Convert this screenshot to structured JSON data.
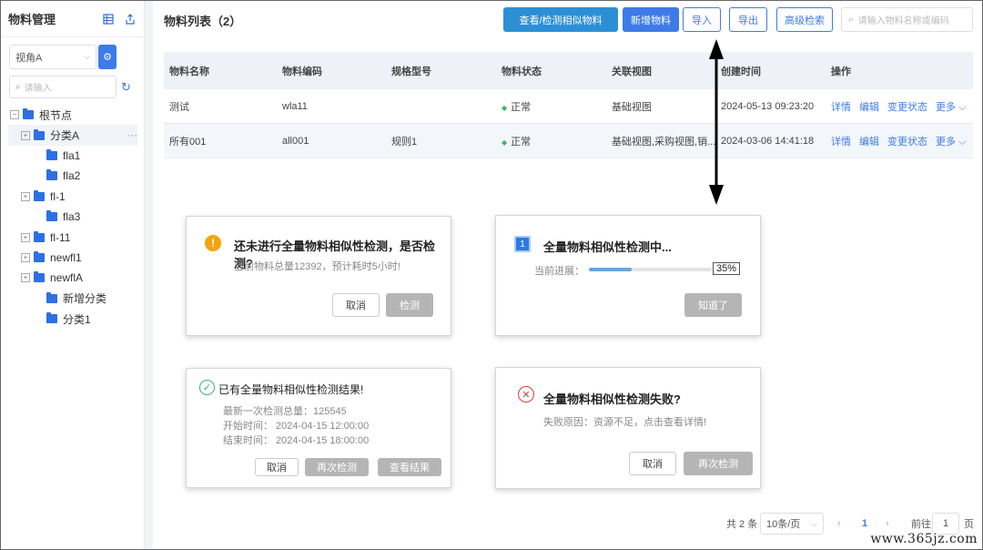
{
  "sidebar": {
    "title": "物料管理",
    "view_select": "视角A",
    "search_placeholder": "请输入",
    "tree": [
      {
        "label": "根节点",
        "expander": "−",
        "indent": 0
      },
      {
        "label": "分类A",
        "expander": "+",
        "indent": 1,
        "selected": true,
        "more": "···"
      },
      {
        "label": "fla1",
        "expander": "",
        "indent": 2
      },
      {
        "label": "fla2",
        "expander": "",
        "indent": 2
      },
      {
        "label": "fl-1",
        "expander": "+",
        "indent": 1
      },
      {
        "label": "fla3",
        "expander": "",
        "indent": 2
      },
      {
        "label": "fl-11",
        "expander": "+",
        "indent": 1
      },
      {
        "label": "newfl1",
        "expander": "+",
        "indent": 1
      },
      {
        "label": "newflA",
        "expander": "+",
        "indent": 1
      },
      {
        "label": "新增分类",
        "expander": "",
        "indent": 2
      },
      {
        "label": "分类1",
        "expander": "",
        "indent": 2
      }
    ]
  },
  "toolbar": {
    "list_title": "物料列表（2）",
    "similar_btn": "查看/检测相似物料",
    "add_btn": "新增物料",
    "import_btn": "导入",
    "export_btn": "导出",
    "advanced_btn": "高级检索",
    "search_placeholder": "请输入物料名称或编码"
  },
  "table": {
    "headers": [
      "物料名称",
      "物料编码",
      "规格型号",
      "物料状态",
      "关联视图",
      "创建时间",
      "操作"
    ],
    "rows": [
      {
        "name": "测试",
        "code": "wla11",
        "spec": "",
        "status": "正常",
        "views": "基础视图",
        "created": "2024-05-13 09:23:20"
      },
      {
        "name": "所有001",
        "code": "all001",
        "spec": "规则1",
        "status": "正常",
        "views": "基础视图,采购视图,销...",
        "created": "2024-03-06 14:41:18"
      }
    ],
    "ops": {
      "detail": "详情",
      "edit": "编辑",
      "change_status": "变更状态",
      "more": "更多"
    }
  },
  "dialogs": {
    "confirm": {
      "title": "还未进行全量物料相似性检测，是否检测?",
      "text": "当前物料总量12392，预计耗时5小时!",
      "cancel": "取消",
      "detect": "检测"
    },
    "progress": {
      "title": "全量物料相似性检测中...",
      "label": "当前进展：",
      "percent_text": "35%",
      "progress": 0.35,
      "ok": "知道了"
    },
    "result": {
      "title": "已有全量物料相似性检测结果!",
      "line1": "最新一次检测总量：125545",
      "line2": "开始时间：  2024-04-15 12:00:00",
      "line3": "结束时间：  2024-04-15 18:00:00",
      "cancel": "取消",
      "redetect": "再次检测",
      "view": "查看结果"
    },
    "failed": {
      "title": "全量物料相似性检测失败?",
      "text": "失败原因：资源不足，点击查看详情!",
      "cancel": "取消",
      "redetect": "再次检测"
    }
  },
  "pager": {
    "total": "共 2 条",
    "page_size": "10条/页",
    "prev": "‹",
    "current": "1",
    "next": "›",
    "goto": "前往",
    "goto_value": "1",
    "page_unit": "页"
  },
  "watermark": "www.365jz.com",
  "colors": {
    "primary": "#2c8fd6",
    "blue": "#3d7be9",
    "status_ok": "#3cb371",
    "error": "#e03b3b",
    "warning": "#f5a30c"
  }
}
